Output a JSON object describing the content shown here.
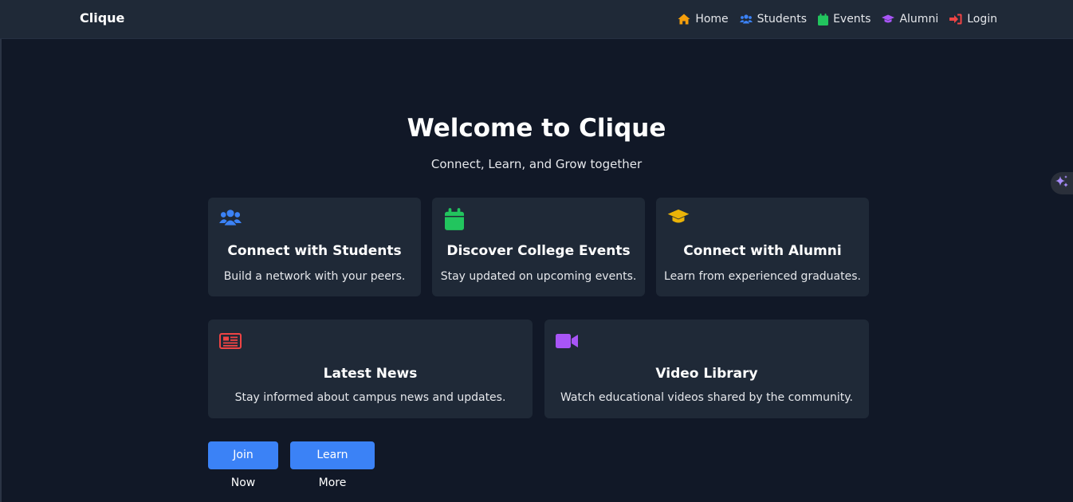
{
  "nav": {
    "brand": "Clique",
    "items": [
      {
        "label": "Home",
        "icon": "home-icon",
        "color": "#f59e0b"
      },
      {
        "label": "Students",
        "icon": "users-icon",
        "color": "#3b82f6"
      },
      {
        "label": "Events",
        "icon": "calendar-icon",
        "color": "#22c55e"
      },
      {
        "label": "Alumni",
        "icon": "graduation-cap-icon",
        "color": "#a855f7"
      },
      {
        "label": "Login",
        "icon": "sign-in-icon",
        "color": "#ef4444"
      }
    ]
  },
  "hero": {
    "title": "Welcome to Clique",
    "subtitle": "Connect, Learn, and Grow together"
  },
  "features": [
    {
      "title": "Connect with Students",
      "description": "Build a network with your peers.",
      "icon": "users-icon",
      "color": "#3b82f6"
    },
    {
      "title": "Discover College Events",
      "description": "Stay updated on upcoming events.",
      "icon": "calendar-icon",
      "color": "#22c55e"
    },
    {
      "title": "Connect with Alumni",
      "description": "Learn from experienced graduates.",
      "icon": "graduation-cap-icon",
      "color": "#eab308"
    },
    {
      "title": "Latest News",
      "description": "Stay informed about campus news and updates.",
      "icon": "newspaper-icon",
      "color": "#ef4444"
    },
    {
      "title": "Video Library",
      "description": "Watch educational videos shared by the community.",
      "icon": "video-icon",
      "color": "#a855f7"
    }
  ],
  "actions": {
    "join_label": "Join Now",
    "learn_label": "Learn More"
  },
  "colors": {
    "background": "#111827",
    "surface": "#1f2937",
    "accent": "#3b82f6"
  }
}
